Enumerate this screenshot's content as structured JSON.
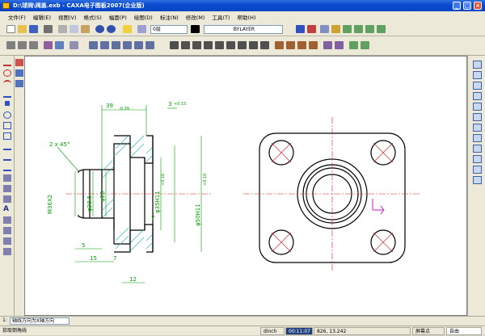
{
  "app": {
    "title": "D:\\球阀\\阀盖.exb - CAXA电子图板2007(企业版)"
  },
  "menu": [
    "文件(F)",
    "编辑(E)",
    "视图(V)",
    "格式(S)",
    "幅面(P)",
    "绘图(D)",
    "标注(N)",
    "修改(M)",
    "工具(T)",
    "帮助(H)"
  ],
  "toolbar": {
    "layer": "0层",
    "linetype": "BYLAYER"
  },
  "drawing": {
    "dims": {
      "d1": "39",
      "d2": "3",
      "d3": "2 x 45°",
      "d4": "M36X2",
      "d5": "φ28.5",
      "d6": "φ20",
      "d7": "φ35H11",
      "d8": "φ50H11",
      "d9": "7",
      "d10": "5",
      "d11": "15",
      "d12": "7",
      "d13": "12",
      "tol1": "-0.39",
      "tol2": "+0.15",
      "tol3": "+0.16",
      "tol4": "+0.16"
    }
  },
  "command": {
    "label": "1:",
    "value": "轴线方向为X轴方向"
  },
  "status": {
    "prompt": "拾取倒角线",
    "unit": "dinch",
    "time": "00:11:07",
    "coords": "826, 13.242",
    "mode_label": "屏幕点",
    "mode_value": "自由"
  }
}
